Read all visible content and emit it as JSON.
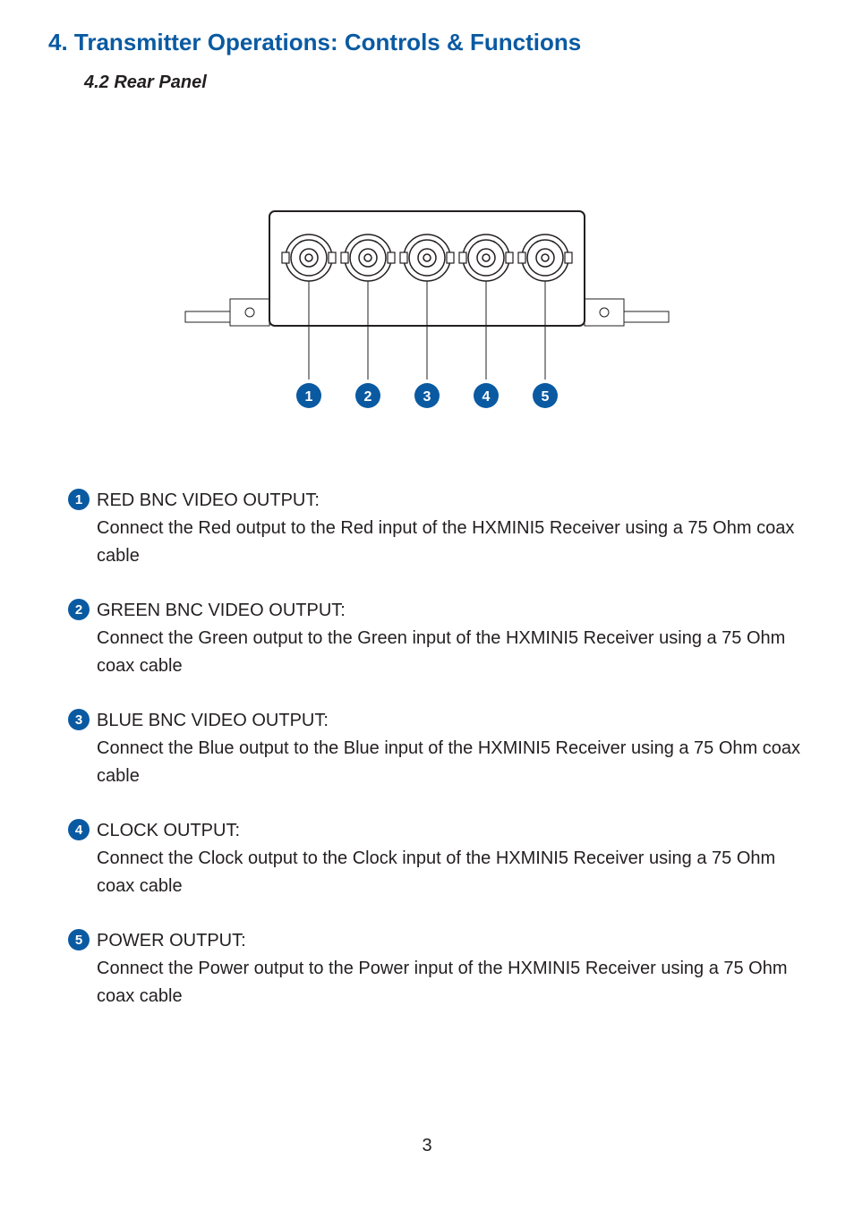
{
  "section": {
    "heading": "4. Transmitter Operations: Controls & Functions",
    "subheading": "4.2 Rear Panel"
  },
  "diagram": {
    "labels": [
      "1",
      "2",
      "3",
      "4",
      "5"
    ]
  },
  "callouts": [
    {
      "num": "1",
      "title": "RED BNC VIDEO OUTPUT:",
      "desc": "Connect the Red output to the Red input of the HXMINI5 Receiver using a 75 Ohm coax cable"
    },
    {
      "num": "2",
      "title": "GREEN BNC VIDEO OUTPUT:",
      "desc": "Connect the Green output to the Green input of the HXMINI5 Receiver using a 75 Ohm coax cable"
    },
    {
      "num": "3",
      "title": "BLUE BNC VIDEO OUTPUT:",
      "desc": "Connect the Blue output to the Blue input of the HXMINI5 Receiver using a 75 Ohm coax cable"
    },
    {
      "num": "4",
      "title": "CLOCK OUTPUT:",
      "desc": "Connect the Clock output to the Clock input of the HXMINI5 Receiver using a 75 Ohm coax cable"
    },
    {
      "num": "5",
      "title": "POWER OUTPUT:",
      "desc": "Connect the Power output to the Power input of the HXMINI5 Receiver using a 75 Ohm coax cable"
    }
  ],
  "pageNumber": "3"
}
